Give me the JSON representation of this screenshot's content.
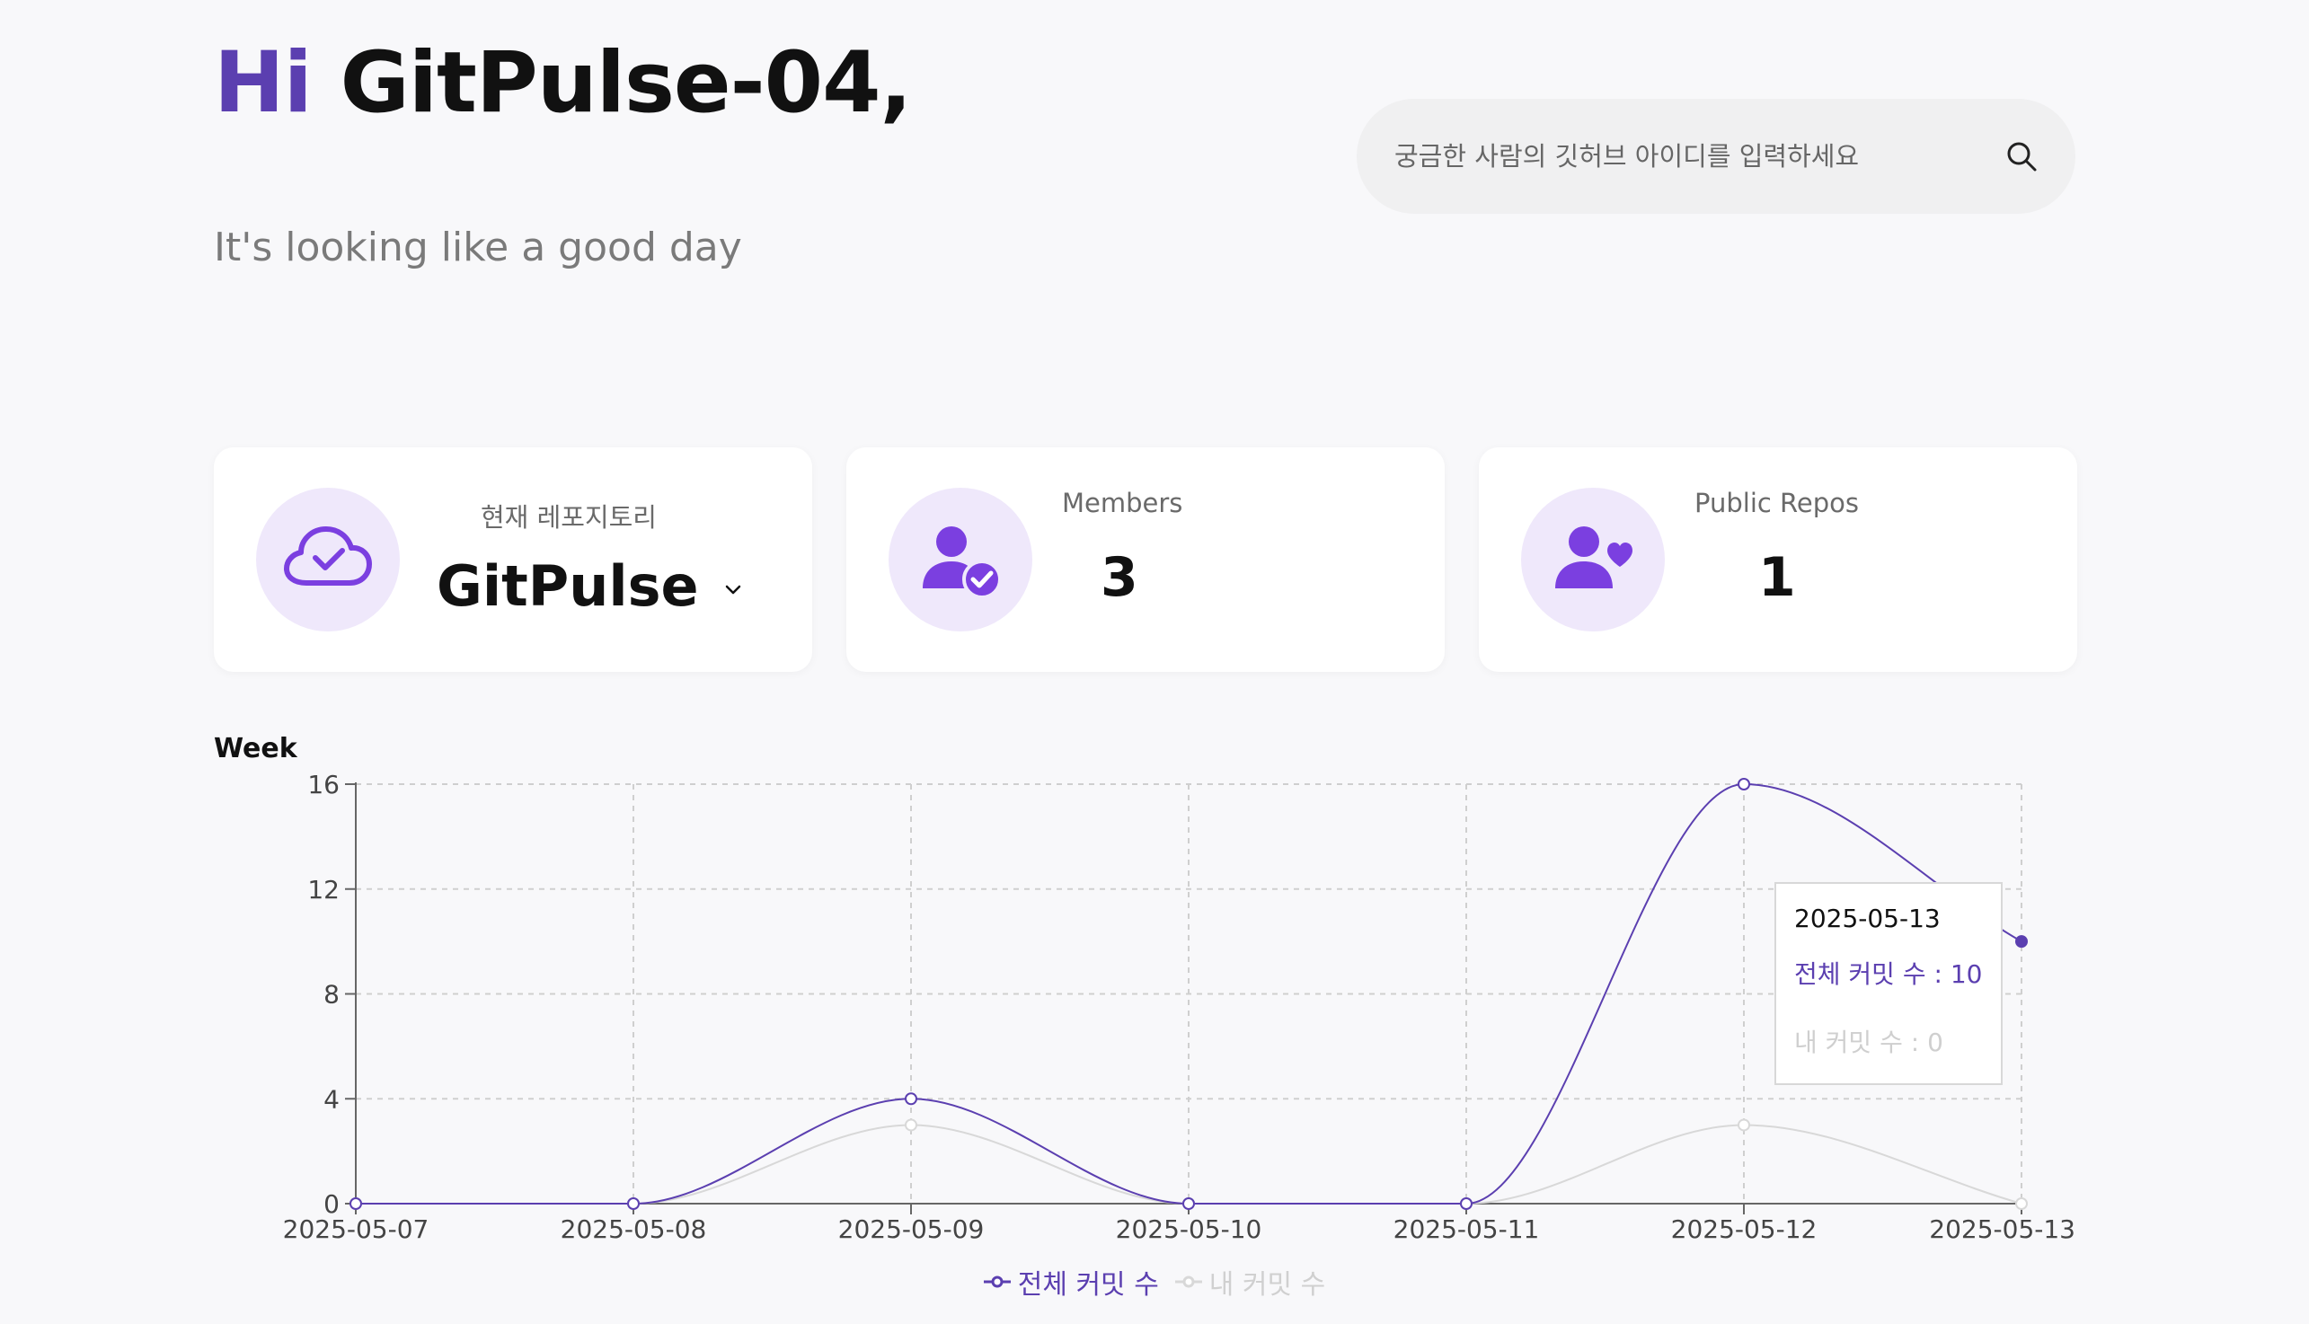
{
  "header": {
    "greeting_prefix": "Hi",
    "username": "GitPulse-04,",
    "subtitle": "It's looking like a good day"
  },
  "search": {
    "placeholder": "궁금한 사람의 깃허브 아이디를 입력하세요",
    "icon": "search-icon"
  },
  "cards": {
    "repo": {
      "label": "현재 레포지토리",
      "value": "GitPulse",
      "icon": "cloud-check-icon"
    },
    "members": {
      "label": "Members",
      "value": "3",
      "icon": "user-check-icon"
    },
    "public_repos": {
      "label": "Public Repos",
      "value": "1",
      "icon": "user-heart-icon"
    }
  },
  "chart": {
    "period_label": "Week",
    "tooltip": {
      "date": "2025-05-13",
      "total_label": "전체 커밋 수 : 10",
      "mine_label": "내 커밋 수 : 0"
    },
    "legend": {
      "total": "전체 커밋 수",
      "mine": "내 커밋 수"
    }
  },
  "colors": {
    "accent": "#5b3fb0",
    "muted_series": "#d8d8d8",
    "icon_bg": "#efe8fb",
    "icon_fg": "#7b3fe0"
  },
  "chart_data": {
    "type": "line",
    "title": "",
    "xlabel": "",
    "ylabel": "",
    "x": [
      "2025-05-07",
      "2025-05-08",
      "2025-05-09",
      "2025-05-10",
      "2025-05-11",
      "2025-05-12",
      "2025-05-13"
    ],
    "series": [
      {
        "name": "전체 커밋 수",
        "values": [
          0,
          0,
          4,
          0,
          0,
          16,
          10
        ]
      },
      {
        "name": "내 커밋 수",
        "values": [
          0,
          0,
          3,
          0,
          0,
          3,
          0
        ]
      }
    ],
    "yticks": [
      "0",
      "4",
      "8",
      "12",
      "16"
    ],
    "ylim": [
      0,
      16
    ],
    "grid": true,
    "legend_position": "bottom-center"
  }
}
